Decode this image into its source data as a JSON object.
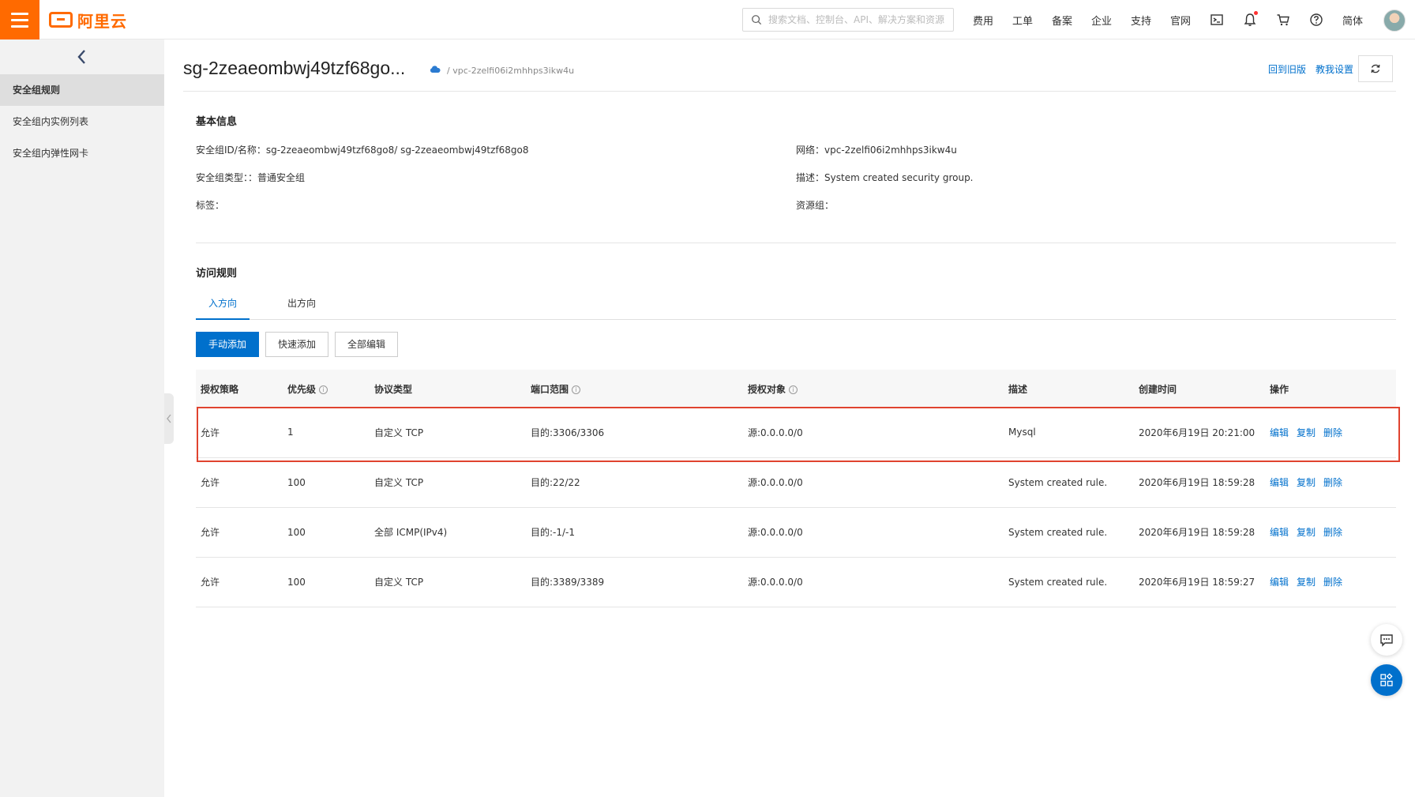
{
  "topbar": {
    "logo_text": "阿里云",
    "search_placeholder": "搜索文档、控制台、API、解决方案和资源",
    "nav": [
      "费用",
      "工单",
      "备案",
      "企业",
      "支持",
      "官网"
    ],
    "lang": "简体",
    "icons": [
      "terminal-icon",
      "bell-icon",
      "cart-icon",
      "help-icon"
    ],
    "accent": "#ff6a00"
  },
  "sidebar": {
    "items": [
      {
        "label": "安全组规则",
        "active": true
      },
      {
        "label": "安全组内实例列表",
        "active": false
      },
      {
        "label": "安全组内弹性网卡",
        "active": false
      }
    ]
  },
  "header": {
    "title": "sg-2zeaeombwj49tzf68go...",
    "breadcrumb": "/ vpc-2zelfi06i2mhhps3ikw4u",
    "link_old": "回到旧版",
    "link_settings": "教我设置"
  },
  "basic_info": {
    "title": "基本信息",
    "sg_id_label": "安全组ID/名称：",
    "sg_id_value": "sg-2zeaeombwj49tzf68go8/ sg-2zeaeombwj49tzf68go8",
    "network_label": "网络：",
    "network_value": "vpc-2zelfi06i2mhhps3ikw4u",
    "type_label": "安全组类型：",
    "type_value": "：普通安全组",
    "desc_label": "描述：",
    "desc_value": "System created security group.",
    "tag_label": "标签：",
    "resgroup_label": "资源组："
  },
  "rules": {
    "title": "访问规则",
    "tabs": [
      "入方向",
      "出方向"
    ],
    "buttons": {
      "manual_add": "手动添加",
      "quick_add": "快速添加",
      "edit_all": "全部编辑"
    },
    "columns": [
      "授权策略",
      "优先级",
      "协议类型",
      "端口范围",
      "授权对象",
      "描述",
      "创建时间",
      "操作"
    ],
    "actions": {
      "edit": "编辑",
      "copy": "复制",
      "delete": "删除"
    },
    "rows": [
      {
        "policy": "允许",
        "priority": "1",
        "protocol": "自定义 TCP",
        "port": "目的:3306/3306",
        "source": "源:0.0.0.0/0",
        "desc": "Mysql",
        "created": "2020年6月19日 20:21:00"
      },
      {
        "policy": "允许",
        "priority": "100",
        "protocol": "自定义 TCP",
        "port": "目的:22/22",
        "source": "源:0.0.0.0/0",
        "desc": "System created rule.",
        "created": "2020年6月19日 18:59:28"
      },
      {
        "policy": "允许",
        "priority": "100",
        "protocol": "全部 ICMP(IPv4)",
        "port": "目的:-1/-1",
        "source": "源:0.0.0.0/0",
        "desc": "System created rule.",
        "created": "2020年6月19日 18:59:28"
      },
      {
        "policy": "允许",
        "priority": "100",
        "protocol": "自定义 TCP",
        "port": "目的:3389/3389",
        "source": "源:0.0.0.0/0",
        "desc": "System created rule.",
        "created": "2020年6月19日 18:59:27"
      }
    ]
  }
}
